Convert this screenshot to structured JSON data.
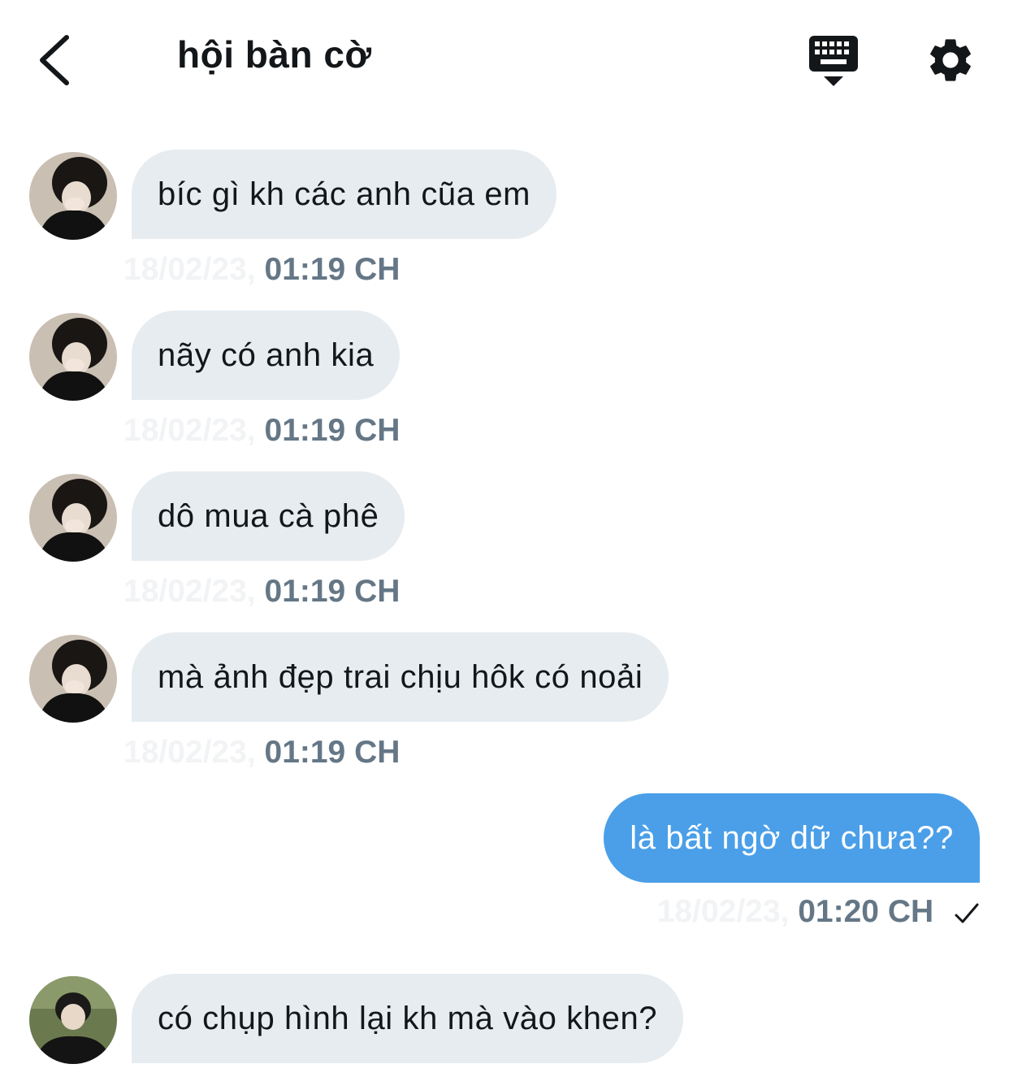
{
  "header": {
    "title": "hội bàn cờ",
    "back_icon": "chevron-left-icon",
    "keyboard_icon": "keyboard-hide-icon",
    "settings_icon": "gear-icon"
  },
  "colors": {
    "incoming_bubble": "#e6ecf0",
    "outgoing_bubble": "#4a9fe8",
    "timestamp": "#657786"
  },
  "messages": [
    {
      "direction": "in",
      "text": "bíc gì kh các anh cũa em",
      "date": "18/02/23,",
      "time": "01:19 CH"
    },
    {
      "direction": "in",
      "text": "nãy có anh kia",
      "date": "18/02/23,",
      "time": "01:19 CH"
    },
    {
      "direction": "in",
      "text": "dô mua cà phê",
      "date": "18/02/23,",
      "time": "01:19 CH"
    },
    {
      "direction": "in",
      "text": "mà ảnh đẹp trai chịu hôk có noải",
      "date": "18/02/23,",
      "time": "01:19 CH"
    },
    {
      "direction": "out",
      "text": "là bất ngờ dữ chưa??",
      "date": "18/02/23,",
      "time": "01:20 CH",
      "status_icon": "sent-check-icon"
    },
    {
      "direction": "in",
      "text": "có chụp hình lại kh mà vào khen?"
    }
  ]
}
